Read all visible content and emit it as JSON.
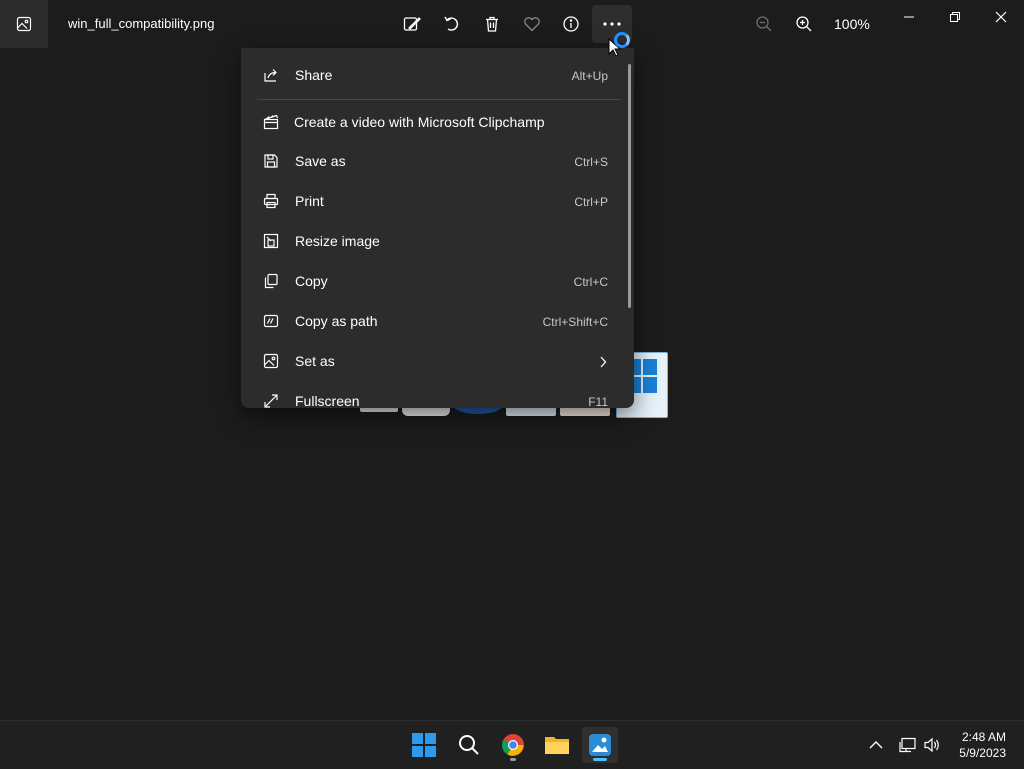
{
  "window": {
    "title": "win_full_compatibility.png",
    "zoom": "100%"
  },
  "toolbar": {
    "icons": [
      "edit-image-icon",
      "rotate-icon",
      "delete-icon",
      "favorite-icon",
      "info-icon",
      "more-options-icon"
    ],
    "zoom_icons": [
      "zoom-out-icon",
      "zoom-in-icon"
    ]
  },
  "menu": {
    "items": [
      {
        "label": "Share",
        "shortcut": "Alt+Up",
        "icon": "share-icon"
      },
      {
        "label": "Create a video with Microsoft Clipchamp",
        "shortcut": "",
        "icon": "clipchamp-icon"
      },
      {
        "label": "Save as",
        "shortcut": "Ctrl+S",
        "icon": "save-icon"
      },
      {
        "label": "Print",
        "shortcut": "Ctrl+P",
        "icon": "print-icon"
      },
      {
        "label": "Resize image",
        "shortcut": "",
        "icon": "resize-icon"
      },
      {
        "label": "Copy",
        "shortcut": "Ctrl+C",
        "icon": "copy-icon"
      },
      {
        "label": "Copy as path",
        "shortcut": "Ctrl+Shift+C",
        "icon": "copy-path-icon"
      },
      {
        "label": "Set as",
        "shortcut": "",
        "icon": "set-as-icon"
      },
      {
        "label": "Fullscreen",
        "shortcut": "F11",
        "icon": "fullscreen-icon"
      }
    ]
  },
  "taskbar": {
    "apps": [
      "start-icon",
      "search-icon",
      "chrome-icon",
      "file-explorer-icon",
      "photos-icon"
    ],
    "time": "2:48 AM",
    "date": "5/9/2023"
  },
  "colors": {
    "background": "#1c1c1c",
    "menu_bg": "#2c2c2c",
    "accent": "#4cc2ff",
    "taskbar_bg": "#202020"
  }
}
